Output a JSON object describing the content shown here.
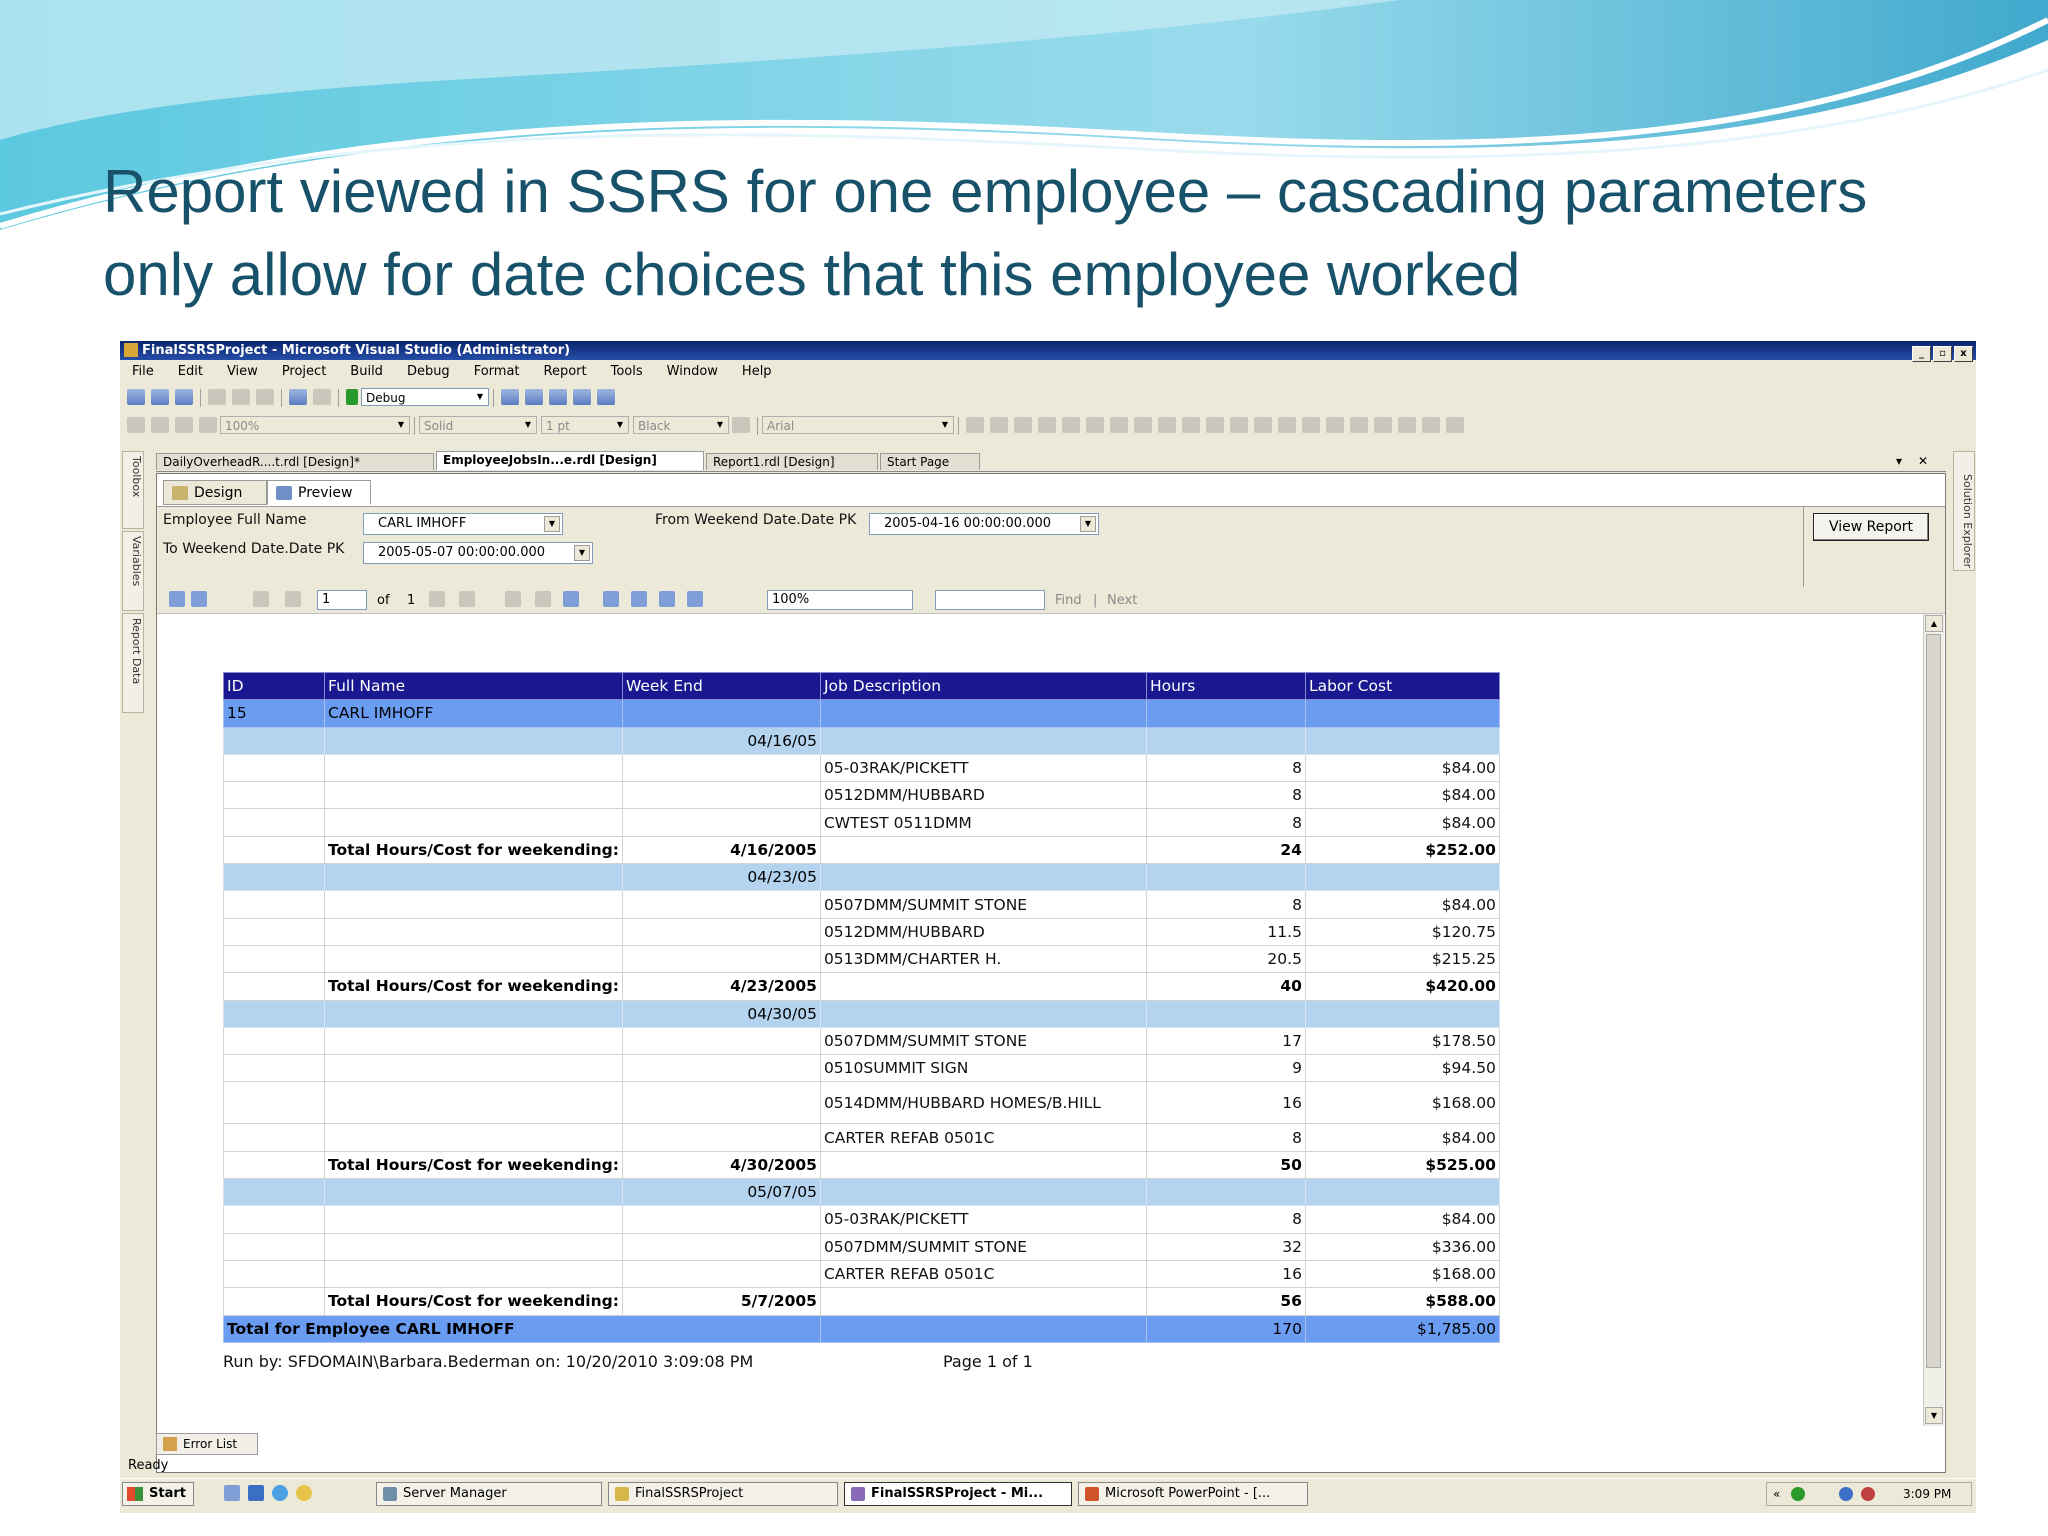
{
  "slide": {
    "title": "Report viewed in SSRS for one employee – cascading parameters only allow for date choices that this employee worked"
  },
  "window": {
    "title": "FinalSSRSProject - Microsoft Visual Studio (Administrator)",
    "controls": [
      "_",
      "▫",
      "x"
    ]
  },
  "menu": [
    "File",
    "Edit",
    "View",
    "Project",
    "Build",
    "Debug",
    "Format",
    "Report",
    "Tools",
    "Window",
    "Help"
  ],
  "toolbar": {
    "config": "Debug",
    "zoom": "100%",
    "border_style": "Solid",
    "border_width": "1 pt",
    "border_color": "Black",
    "font": "Arial"
  },
  "side_panels": {
    "left": [
      "Toolbox",
      "Variables",
      "Report Data"
    ],
    "right": "Solution Explorer"
  },
  "doc_tabs": [
    {
      "label": "DailyOverheadR....t.rdl [Design]*",
      "active": false
    },
    {
      "label": "EmployeeJobsIn...e.rdl [Design]",
      "active": true
    },
    {
      "label": "Report1.rdl [Design]",
      "active": false
    },
    {
      "label": "Start Page",
      "active": false
    }
  ],
  "doc_controls": {
    "dropdown": "▾",
    "close": "✕"
  },
  "designer_tabs": [
    "Design",
    "Preview"
  ],
  "params": {
    "employee_label": "Employee Full Name",
    "employee_value": "CARL IMHOFF",
    "from_label": "From Weekend Date.Date PK",
    "from_value": "2005-04-16 00:00:00.000",
    "to_label": "To Weekend Date.Date PK",
    "to_value": "2005-05-07 00:00:00.000",
    "view_report": "View Report"
  },
  "viewer": {
    "page_current": "1",
    "of_label": "of",
    "page_total": "1",
    "zoom": "100%",
    "find": "Find",
    "divider": "|",
    "next": "Next"
  },
  "report": {
    "columns": [
      "ID",
      "Full Name",
      "Week End",
      "Job Description",
      "Hours",
      "Labor Cost"
    ],
    "employee": {
      "id": "15",
      "name": "CARL IMHOFF"
    },
    "total_label": "Total Hours/Cost for weekending:",
    "weeks": [
      {
        "week_end": "04/16/05",
        "jobs": [
          {
            "desc": "05-03RAK/PICKETT",
            "hours": "8",
            "cost": "$84.00"
          },
          {
            "desc": "0512DMM/HUBBARD",
            "hours": "8",
            "cost": "$84.00"
          },
          {
            "desc": "CWTEST 0511DMM",
            "hours": "8",
            "cost": "$84.00"
          }
        ],
        "total_date": "4/16/2005",
        "total_hours": "24",
        "total_cost": "$252.00"
      },
      {
        "week_end": "04/23/05",
        "jobs": [
          {
            "desc": "0507DMM/SUMMIT STONE",
            "hours": "8",
            "cost": "$84.00"
          },
          {
            "desc": "0512DMM/HUBBARD",
            "hours": "11.5",
            "cost": "$120.75"
          },
          {
            "desc": "0513DMM/CHARTER H.",
            "hours": "20.5",
            "cost": "$215.25"
          }
        ],
        "total_date": "4/23/2005",
        "total_hours": "40",
        "total_cost": "$420.00"
      },
      {
        "week_end": "04/30/05",
        "jobs": [
          {
            "desc": "0507DMM/SUMMIT STONE",
            "hours": "17",
            "cost": "$178.50"
          },
          {
            "desc": "0510SUMMIT SIGN",
            "hours": "9",
            "cost": "$94.50"
          },
          {
            "desc": "0514DMM/HUBBARD HOMES/B.HILL",
            "hours": "16",
            "cost": "$168.00"
          },
          {
            "desc": "CARTER REFAB   0501C",
            "hours": "8",
            "cost": "$84.00"
          }
        ],
        "total_date": "4/30/2005",
        "total_hours": "50",
        "total_cost": "$525.00"
      },
      {
        "week_end": "05/07/05",
        "jobs": [
          {
            "desc": "05-03RAK/PICKETT",
            "hours": "8",
            "cost": "$84.00"
          },
          {
            "desc": "0507DMM/SUMMIT STONE",
            "hours": "32",
            "cost": "$336.00"
          },
          {
            "desc": "CARTER REFAB   0501C",
            "hours": "16",
            "cost": "$168.00"
          }
        ],
        "total_date": "5/7/2005",
        "total_hours": "56",
        "total_cost": "$588.00"
      }
    ],
    "grand": {
      "label": "Total for Employee CARL IMHOFF",
      "hours": "170",
      "cost": "$1,785.00"
    },
    "footer_run": "Run by:  SFDOMAIN\\Barbara.Bederman on:  10/20/2010 3:09:08 PM",
    "footer_page": "Page 1 of 1"
  },
  "error_list": "Error List",
  "status": "Ready",
  "taskbar": {
    "start": "Start",
    "buttons": [
      {
        "label": "Server Manager",
        "active": false
      },
      {
        "label": "FinalSSRSProject",
        "active": false
      },
      {
        "label": "FinalSSRSProject - Mi...",
        "active": true
      },
      {
        "label": "Microsoft PowerPoint - [...",
        "active": false
      }
    ],
    "tray_arrows": "«",
    "time": "3:09 PM"
  }
}
